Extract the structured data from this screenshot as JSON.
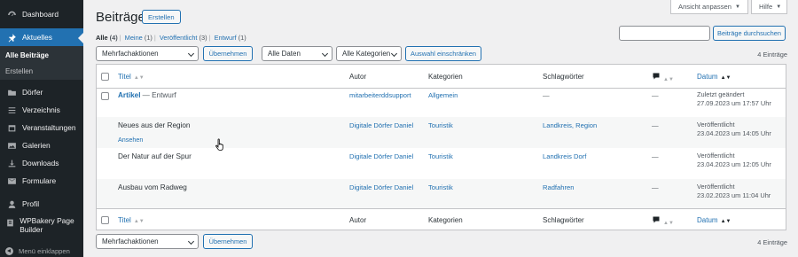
{
  "sidebar": {
    "items": [
      {
        "label": "Dashboard",
        "icon": "dashboard-icon"
      },
      {
        "label": "Aktuelles",
        "icon": "pin-icon"
      },
      {
        "label": "Dörfer",
        "icon": "folder-icon"
      },
      {
        "label": "Verzeichnis",
        "icon": "list-icon"
      },
      {
        "label": "Veranstaltungen",
        "icon": "calendar-icon"
      },
      {
        "label": "Galerien",
        "icon": "gallery-icon"
      },
      {
        "label": "Downloads",
        "icon": "download-icon"
      },
      {
        "label": "Formulare",
        "icon": "form-icon"
      },
      {
        "label": "Profil",
        "icon": "user-icon"
      },
      {
        "label": "WPBakery Page Builder",
        "icon": "builder-icon"
      }
    ],
    "submenu": [
      "Alle Beiträge",
      "Erstellen"
    ],
    "collapse_label": "Menü einklappen"
  },
  "header": {
    "screen_options": "Ansicht anpassen",
    "help": "Hilfe",
    "title": "Beiträge",
    "new_button": "Erstellen"
  },
  "views": [
    {
      "label": "Alle",
      "count": "(4)"
    },
    {
      "label": "Meine",
      "count": "(1)"
    },
    {
      "label": "Veröffentlicht",
      "count": "(3)"
    },
    {
      "label": "Entwurf",
      "count": "(1)"
    }
  ],
  "search": {
    "button": "Beiträge durchsuchen",
    "value": ""
  },
  "filters": {
    "bulk_action": "Mehrfachaktionen",
    "apply": "Übernehmen",
    "dates": "Alle Daten",
    "categories": "Alle Kategorien",
    "filter_button": "Auswahl einschränken",
    "count": "4 Einträge"
  },
  "table": {
    "columns": {
      "title": "Titel",
      "author": "Autor",
      "categories": "Kategorien",
      "tags": "Schlagwörter",
      "date": "Datum"
    },
    "rows": [
      {
        "title": "Artikel",
        "suffix": "— Entwurf",
        "author": "mitarbeiterddsupport",
        "category": "Allgemein",
        "tags": "—",
        "comments": "—",
        "status": "Zuletzt geändert",
        "date": "27.09.2023 um 17:57 Uhr"
      },
      {
        "title": "Neues aus der Region",
        "suffix": "",
        "action": "Ansehen",
        "author": "Digitale Dörfer Daniel",
        "category": "Touristik",
        "tags": "Landkreis, Region",
        "comments": "—",
        "status": "Veröffentlicht",
        "date": "23.04.2023 um 14:05 Uhr"
      },
      {
        "title": "Der Natur auf der Spur",
        "suffix": "",
        "author": "Digitale Dörfer Daniel",
        "category": "Touristik",
        "tags": "Landkreis Dorf",
        "comments": "—",
        "status": "Veröffentlicht",
        "date": "23.04.2023 um 12:05 Uhr"
      },
      {
        "title": "Ausbau vom Radweg",
        "suffix": "",
        "author": "Digitale Dörfer Daniel",
        "category": "Touristik",
        "tags": "Radfahren",
        "comments": "—",
        "status": "Veröffentlicht",
        "date": "23.02.2023 um 11:04 Uhr"
      }
    ]
  },
  "colors": {
    "sidebar_bg": "#1d2327",
    "accent": "#2271b1",
    "page_bg": "#f0f0f1"
  }
}
